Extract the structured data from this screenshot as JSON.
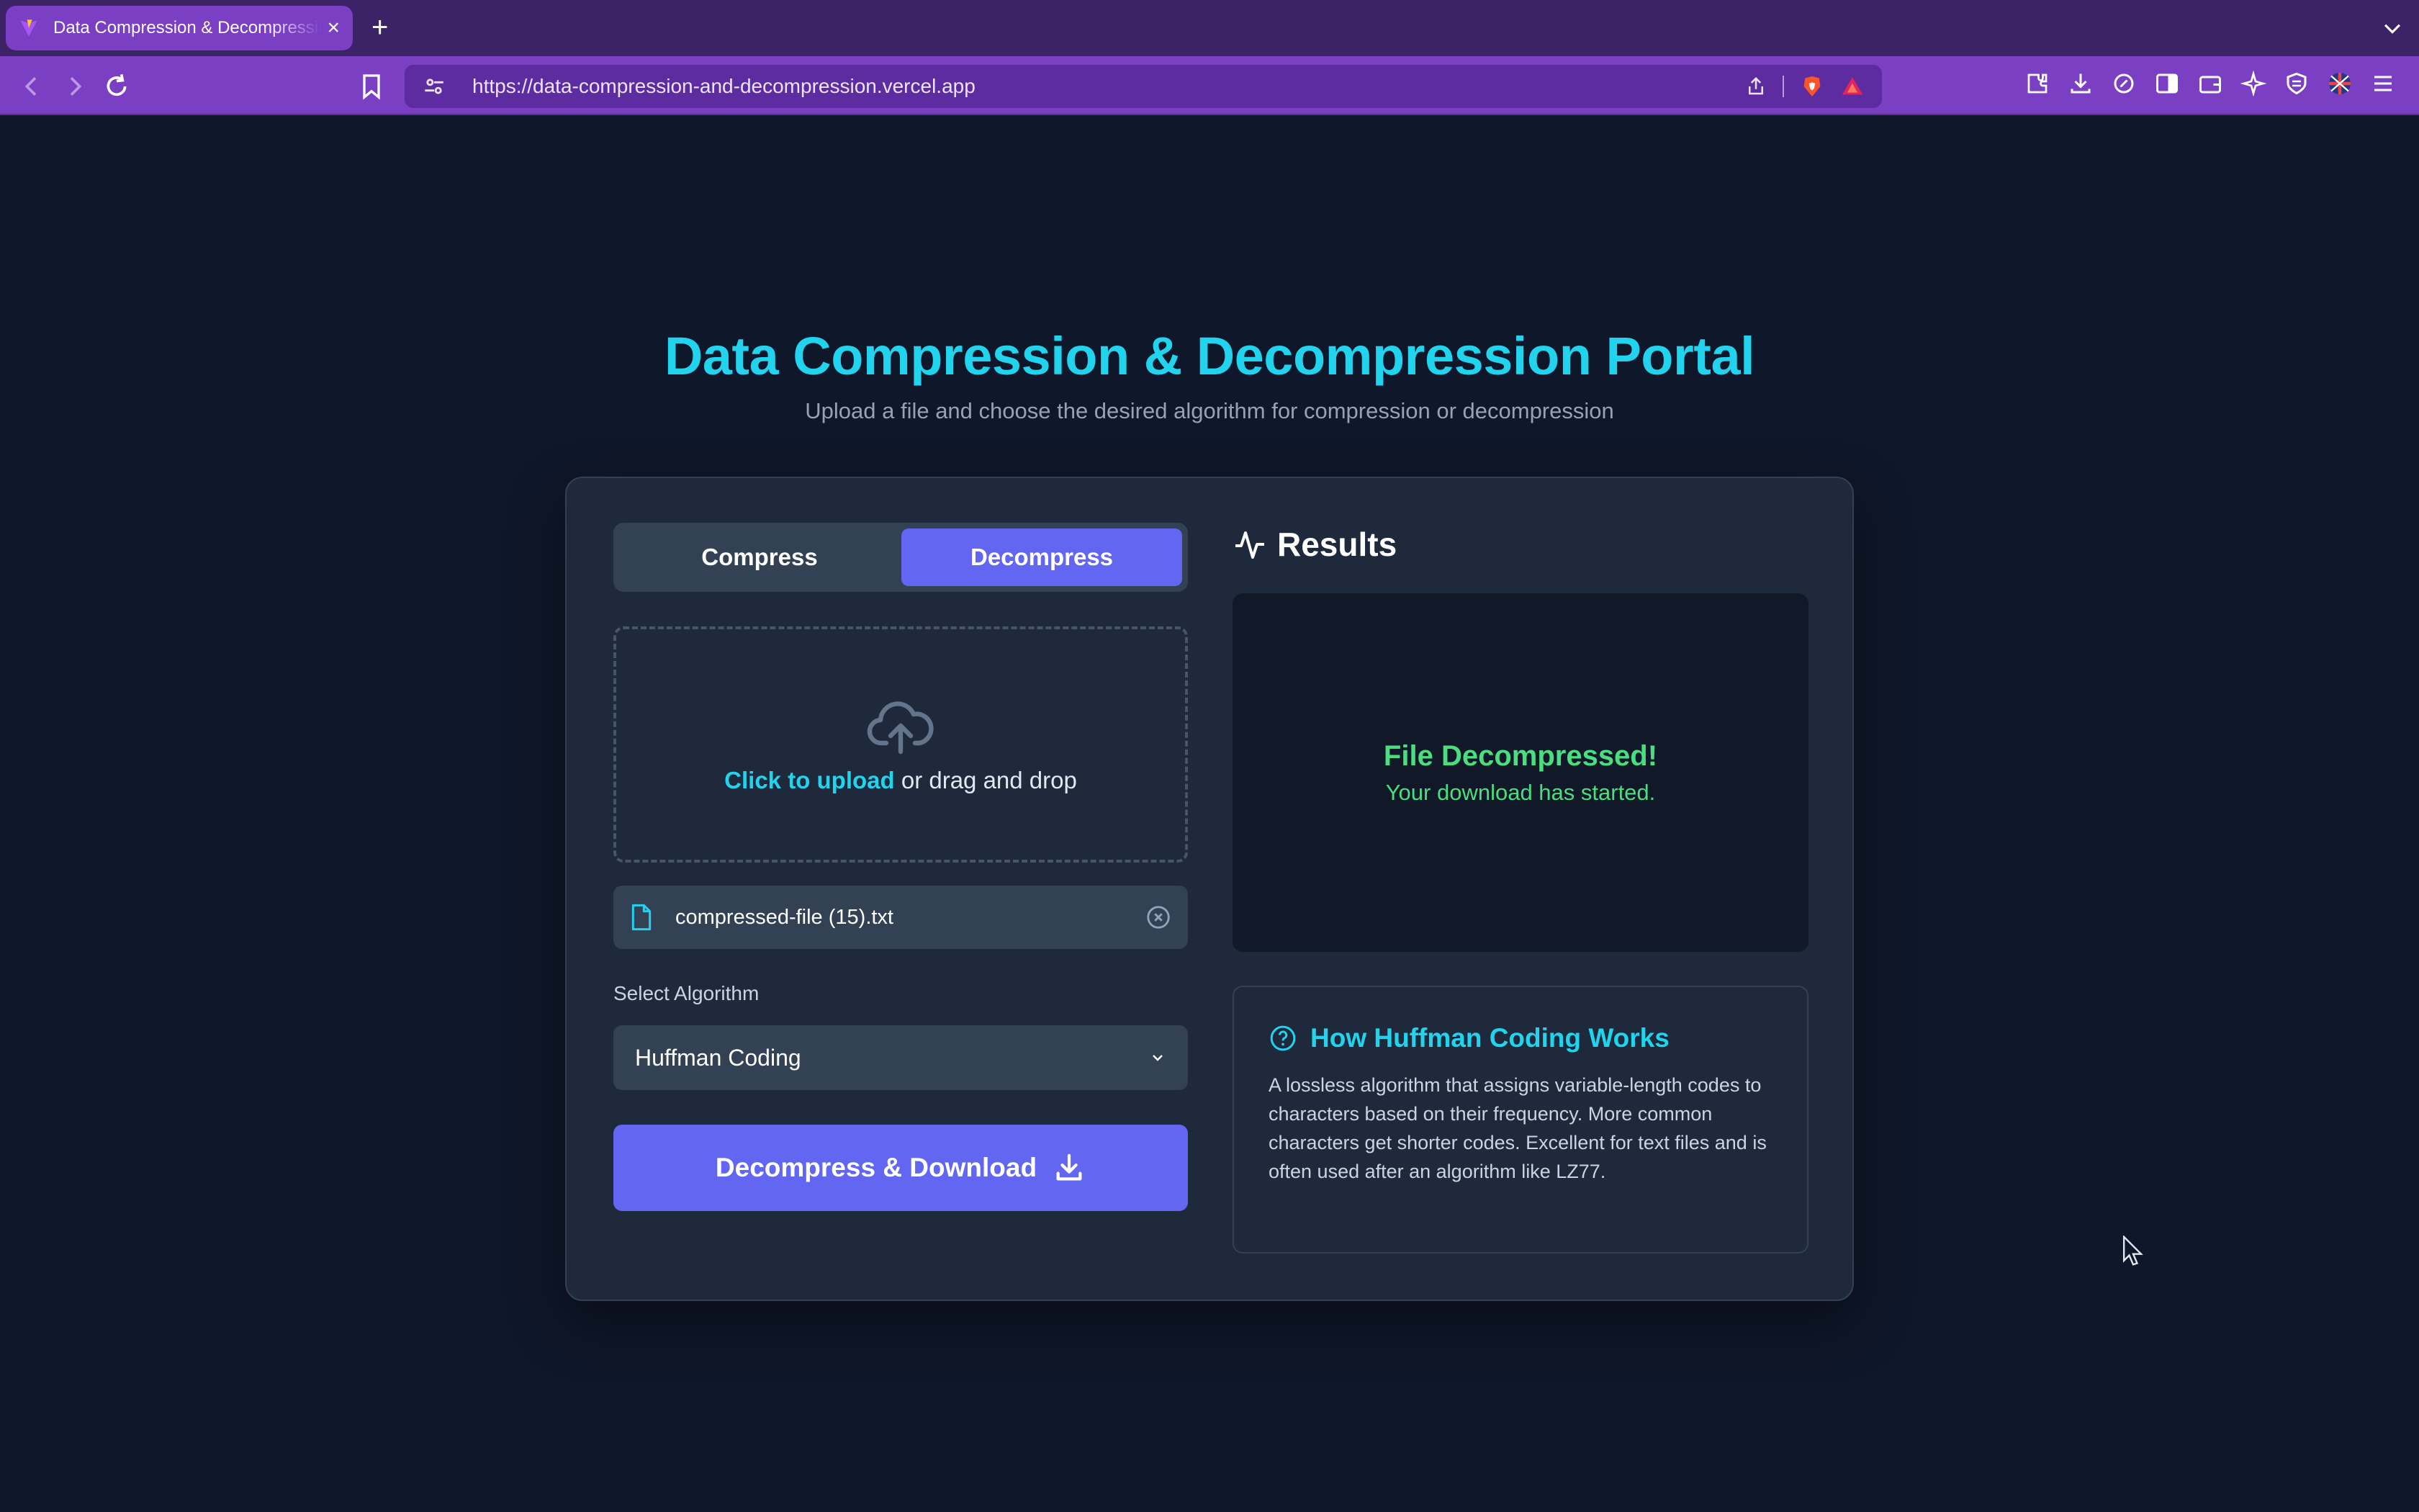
{
  "browser": {
    "tab_title": "Data Compression & Decompression Portal",
    "tab_close": "×",
    "new_tab": "+",
    "url": "https://data-compression-and-decompression.vercel.app"
  },
  "page": {
    "title": "Data Compression & Decompression Portal",
    "subtitle": "Upload a file and choose the desired algorithm for compression or decompression"
  },
  "mode_toggle": {
    "compress_label": "Compress",
    "decompress_label": "Decompress",
    "selected": "Decompress"
  },
  "upload": {
    "link_text": "Click to upload",
    "rest_text": " or drag and drop"
  },
  "file": {
    "name": "compressed-file (15).txt"
  },
  "algorithm": {
    "label": "Select Algorithm",
    "selected": "Huffman Coding"
  },
  "action": {
    "label": "Decompress & Download"
  },
  "results": {
    "title": "Results",
    "status": "File Decompressed!",
    "message": "Your download has started."
  },
  "info": {
    "title": "How Huffman Coding Works",
    "body": "A lossless algorithm that assigns variable-length codes to characters based on their frequency. More common characters get shorter codes. Excellent for text files and is often used after an algorithm like LZ77."
  },
  "colors": {
    "accent": "#6366f1",
    "cyan": "#22d3ee",
    "success": "#4ade80",
    "background": "#0f172a",
    "browser_frame": "#7b3fc4"
  }
}
